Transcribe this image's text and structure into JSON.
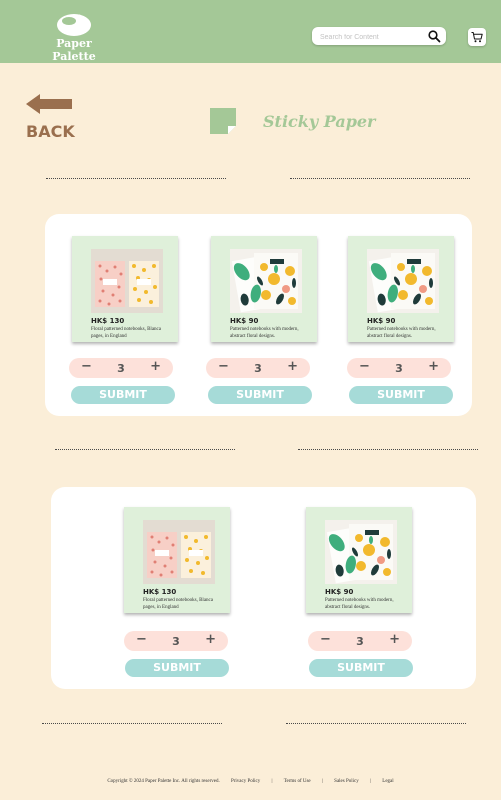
{
  "header": {
    "logo_text": "Paper Palette",
    "search_placeholder": "Search for Content",
    "search_icon": "search-icon",
    "cart_icon": "cart-icon",
    "color": "#a4c897"
  },
  "nav": {
    "back_label": "BACK",
    "back_icon": "arrow-left-icon"
  },
  "page": {
    "title": "Sticky Paper",
    "title_icon": "sticky-note-icon"
  },
  "colors": {
    "background": "#fbeed8",
    "card": "#dff0da",
    "stepper": "#fde1da",
    "submit": "#a6dbd8",
    "brown": "#9a6f4e"
  },
  "sections": [
    {
      "products": [
        {
          "price": "HK$ 130",
          "description": "Floral patterned notebooks, Blanca pages, in England",
          "image": "pink-and-yellow-notebooks",
          "quantity": "3",
          "minus": "−",
          "plus": "+",
          "submit_label": "SUBMIT"
        },
        {
          "price": "HK$ 90",
          "description": "Patterned notebooks with modern, abstract floral designs.",
          "image": "floral-notebooks",
          "quantity": "3",
          "minus": "−",
          "plus": "+",
          "submit_label": "SUBMIT"
        },
        {
          "price": "HK$ 90",
          "description": "Patterned notebooks with modern, abstract floral designs.",
          "image": "floral-notebooks",
          "quantity": "3",
          "minus": "−",
          "plus": "+",
          "submit_label": "SUBMIT"
        }
      ]
    },
    {
      "products": [
        {
          "price": "HK$ 130",
          "description": "Floral patterned notebooks, Blanca pages, in England",
          "image": "pink-and-yellow-notebooks",
          "quantity": "3",
          "minus": "−",
          "plus": "+",
          "submit_label": "SUBMIT"
        },
        {
          "price": "HK$ 90",
          "description": "Patterned notebooks with modern, abstract floral designs.",
          "image": "floral-notebooks",
          "quantity": "3",
          "minus": "−",
          "plus": "+",
          "submit_label": "SUBMIT"
        }
      ]
    }
  ],
  "footer": {
    "copyright": "Copyright © 2024 Paper Palette Inc. All rights reserved.",
    "separator": "|",
    "links": [
      "Privacy Policy",
      "Terms of Use",
      "Sales Policy",
      "Legal"
    ]
  }
}
